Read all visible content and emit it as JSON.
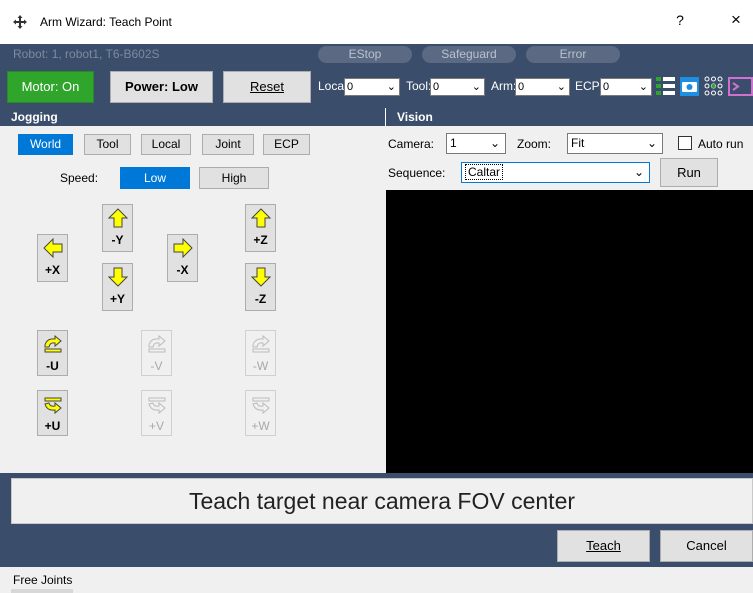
{
  "window": {
    "title": "Arm Wizard: Teach Point",
    "help": "?",
    "close": "×"
  },
  "status": {
    "robot": "Robot: 1, robot1, T6-B602S",
    "estop": "EStop",
    "safeguard": "Safeguard",
    "error": "Error"
  },
  "toolbar": {
    "motor": "Motor: On",
    "power": "Power: Low",
    "reset": "Reset",
    "local_label": "Local:",
    "local_value": "0",
    "tool_label": "Tool:",
    "tool_value": "0",
    "arm_label": "Arm:",
    "arm_value": "0",
    "ecp_label": "ECP:",
    "ecp_value": "0"
  },
  "jogging": {
    "header": "Jogging",
    "modes": [
      "World",
      "Tool",
      "Local",
      "Joint",
      "ECP"
    ],
    "active_mode": "World",
    "speed_label": "Speed:",
    "speed_low": "Low",
    "speed_high": "High",
    "buttons": {
      "neg_y": "-Y",
      "pos_y": "+Y",
      "pos_x": "+X",
      "neg_x": "-X",
      "pos_z": "+Z",
      "neg_z": "-Z",
      "neg_u": "-U",
      "pos_u": "+U",
      "neg_v": "-V",
      "pos_v": "+V",
      "neg_w": "-W",
      "pos_w": "+W"
    }
  },
  "vision": {
    "header": "Vision",
    "camera_label": "Camera:",
    "camera_value": "1",
    "zoom_label": "Zoom:",
    "zoom_value": "Fit",
    "auto_run": "Auto run",
    "sequence_label": "Sequence:",
    "sequence_value": "Caltar",
    "run": "Run"
  },
  "message": "Teach target near camera FOV center",
  "actions": {
    "teach": "Teach",
    "cancel": "Cancel"
  },
  "footer": {
    "label": "Free Joints"
  },
  "colors": {
    "navy": "#3a4d6a",
    "accent": "#0078d7",
    "motor_on": "#2fa52c",
    "arrow": "#ffff00"
  }
}
